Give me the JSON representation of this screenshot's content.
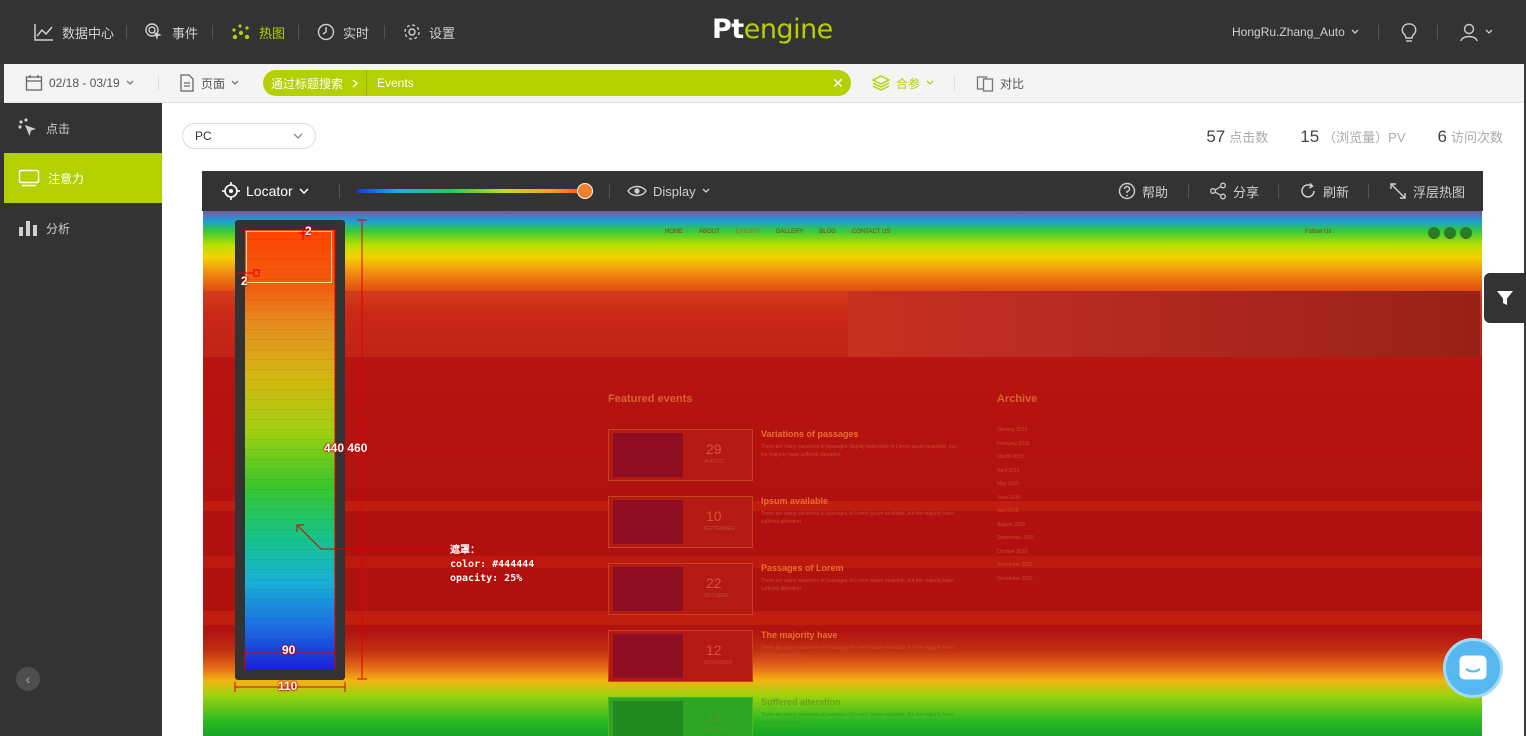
{
  "topnav": {
    "items": [
      {
        "label": "数据中心",
        "icon": "line-chart-icon"
      },
      {
        "label": "事件",
        "icon": "cursor-click-icon"
      },
      {
        "label": "热图",
        "icon": "heatmap-dots-icon",
        "active": true
      },
      {
        "label": "实时",
        "icon": "clock-icon"
      },
      {
        "label": "设置",
        "icon": "gear-icon"
      }
    ],
    "logo_part1": "Pt",
    "logo_part2": "engine",
    "username": "HongRu.Zhang_Auto"
  },
  "filterbar": {
    "date_range": "02/18 - 03/19",
    "page_label": "页面",
    "search_label": "通过标题搜索",
    "search_value": "Events",
    "merge_label": "合参",
    "compare_label": "对比"
  },
  "sidebar": {
    "items": [
      {
        "label": "点击",
        "icon": "click-icon"
      },
      {
        "label": "注意力",
        "icon": "attention-monitor-icon",
        "active": true
      },
      {
        "label": "分析",
        "icon": "bar-chart-icon"
      }
    ]
  },
  "main": {
    "device": "PC",
    "stats": [
      {
        "value": "57",
        "label": "点击数"
      },
      {
        "value": "15",
        "label": "（浏览量）PV"
      },
      {
        "value": "6",
        "label": "访问次数"
      }
    ]
  },
  "heatmap_toolbar": {
    "locator_label": "Locator",
    "display_label": "Display",
    "help_label": "帮助",
    "share_label": "分享",
    "refresh_label": "刷新",
    "overlay_label": "浮层热图",
    "slider_level": 1.0
  },
  "site_preview": {
    "nav": [
      "HOME",
      "ABOUT",
      "EVENTS",
      "GALLERY",
      "BLOG",
      "CONTACT US"
    ],
    "follow": "Follow Us :",
    "featured_title": "Featured events",
    "archive_title": "Archive",
    "events": [
      {
        "day": "29",
        "month": "AUGUST",
        "title": "Variations of passages",
        "desc": "There are many variations of passages Slightly believable of Lorem Ipsum available, but the majority have suffered alteration"
      },
      {
        "day": "10",
        "month": "SEPTEMBER",
        "title": "Ipsum available",
        "desc": "There are many variations of passages of Lorem Ipsum available, but the majority have suffered alteration"
      },
      {
        "day": "22",
        "month": "OCTOBER",
        "title": "Passages of Lorem",
        "desc": "There are many variations of passages of Lorem Ipsum available, but the majority have suffered alteration"
      },
      {
        "day": "12",
        "month": "NOVEMBER",
        "title": "The majority have",
        "desc": "There are many variations of passages of Lorem Ipsum available, but the majority have suffered alteration"
      },
      {
        "day": "23",
        "month": "DECEMBER",
        "title": "Suffered alteration",
        "desc": "There are many variations of passages of Lorem Ipsum available, but the majority have suffered alteration"
      }
    ],
    "archive": [
      "January 2015",
      "February 2015",
      "March 2015",
      "April 2015",
      "May 2015",
      "June 2015",
      "July 2015",
      "August 2015",
      "September 2015",
      "October 2015",
      "November 2015",
      "December 2015"
    ]
  },
  "annotations": {
    "top_mark": "2",
    "left_mark": "2",
    "height_mark": "440 460",
    "inner_width": "90",
    "outer_width": "110",
    "mask_lines": [
      "遮罩：",
      "color: #444444",
      "opacity: 25%"
    ]
  },
  "colors": {
    "accent": "#b5d000",
    "dark": "#333333",
    "annotation": "#e00000"
  }
}
